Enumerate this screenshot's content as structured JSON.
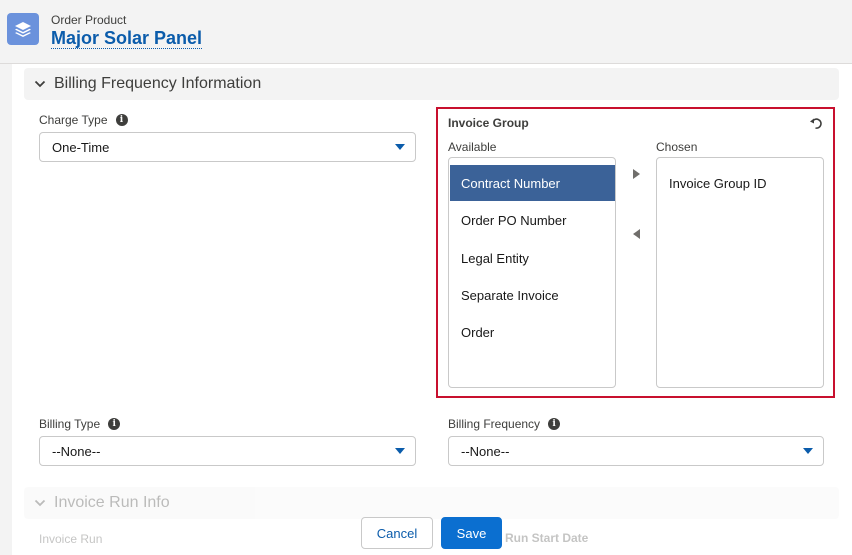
{
  "header": {
    "object_type": "Order Product",
    "record_name": "Major Solar Panel",
    "icon": "stack-layers-icon"
  },
  "section_billing": {
    "title": "Billing Frequency Information",
    "expanded": true
  },
  "charge_type": {
    "label": "Charge Type",
    "value": "One-Time"
  },
  "invoice_group": {
    "title": "Invoice Group",
    "available_label": "Available",
    "chosen_label": "Chosen",
    "available": [
      "Contract Number",
      "Order PO Number",
      "Legal Entity",
      "Separate Invoice",
      "Order"
    ],
    "selected_available": "Contract Number",
    "chosen": [
      "Invoice Group ID"
    ],
    "highlight_color": "#c8102e"
  },
  "billing_type": {
    "label": "Billing Type",
    "value": "--None--"
  },
  "billing_frequency": {
    "label": "Billing Frequency",
    "value": "--None--"
  },
  "section_invoice_run": {
    "title": "Invoice Run Info",
    "field_left": "Invoice Run",
    "field_right": "Run Start Date"
  },
  "footer": {
    "cancel": "Cancel",
    "save": "Save"
  },
  "colors": {
    "brand": "#0b5cab",
    "save_button": "#0b6fd0",
    "selected_option": "#3b6298"
  }
}
